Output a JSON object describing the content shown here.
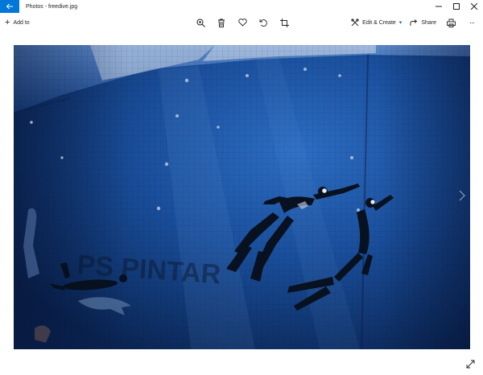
{
  "window": {
    "title": "Photos - freedive.jpg"
  },
  "toolbar": {
    "add_to_label": "Add to",
    "edit_create_label": "Edit & Create",
    "share_label": "Share",
    "more_label": "···"
  },
  "photo": {
    "wall_text": "PS PINTAR"
  },
  "icons": {
    "back": "back-arrow-icon",
    "zoom": "zoom-icon",
    "delete": "trash-icon",
    "favorite": "heart-icon",
    "rotate": "rotate-icon",
    "crop": "crop-icon",
    "edit": "edit-create-icon",
    "share": "share-icon",
    "print": "print-icon",
    "expand": "expand-icon"
  },
  "colors": {
    "accent": "#0078d7",
    "water_deep": "#0b2a5a",
    "water_mid": "#1a4f9c"
  }
}
